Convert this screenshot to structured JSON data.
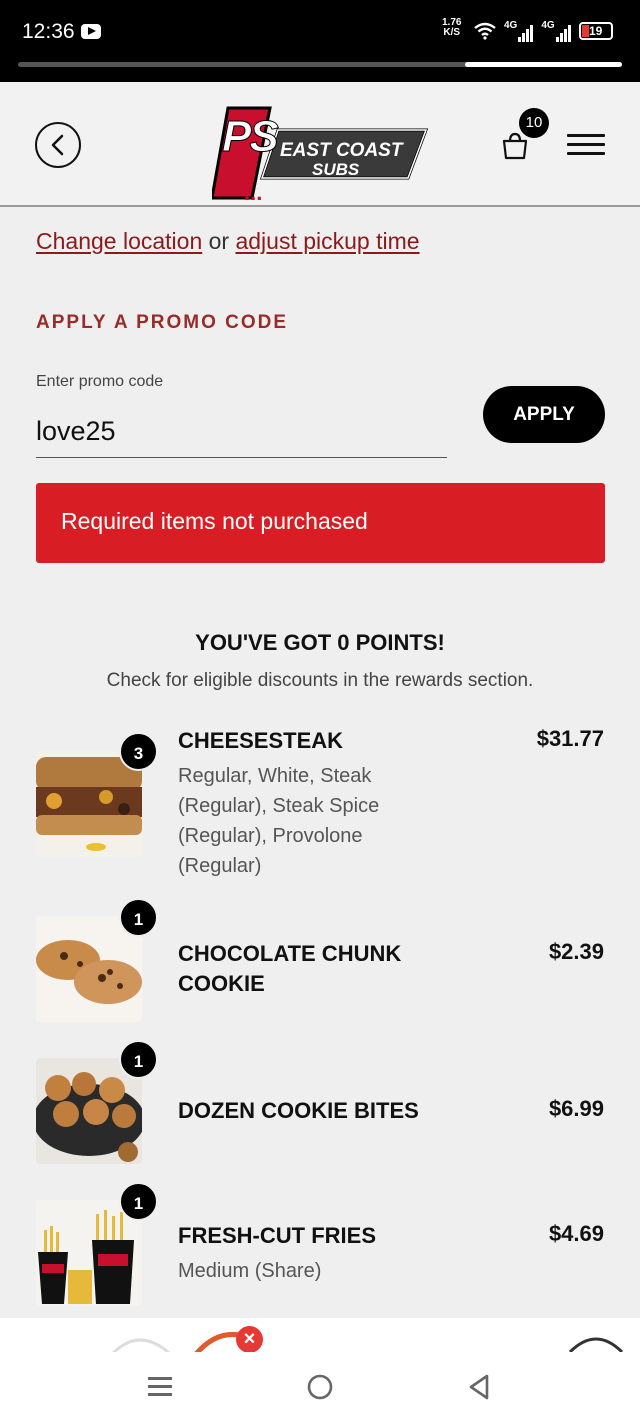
{
  "status_bar": {
    "time": "12:36",
    "net_speed_value": "1.76",
    "net_speed_unit": "K/S",
    "signal1": "4G",
    "signal2": "4G",
    "battery": "19"
  },
  "header": {
    "logo_text": "PS... EAST COAST SUBS",
    "logo_ps": "PS",
    "logo_line1": "EAST COAST",
    "logo_line2": "SUBS",
    "cart_count": "10"
  },
  "location": {
    "change_link": "Change location",
    "or_text": " or ",
    "pickup_link": "adjust pickup time"
  },
  "promo": {
    "heading": "APPLY A PROMO CODE",
    "label": "Enter promo code",
    "value": "love25",
    "apply_label": "APPLY",
    "error": "Required items not purchased"
  },
  "points": {
    "title": "YOU'VE GOT 0 POINTS!",
    "subtitle": "Check for eligible discounts in the rewards section."
  },
  "items": [
    {
      "qty": "3",
      "name": "CHEESESTEAK",
      "price": "$31.77",
      "desc": "Regular, White, Steak (Regular), Steak Spice (Regular), Provolone (Regular)"
    },
    {
      "qty": "1",
      "name": "CHOCOLATE CHUNK COOKIE",
      "price": "$2.39",
      "desc": ""
    },
    {
      "qty": "1",
      "name": "DOZEN COOKIE BITES",
      "price": "$6.99",
      "desc": ""
    },
    {
      "qty": "1",
      "name": "FRESH-CUT FRIES",
      "price": "$4.69",
      "desc": "Medium (Share)"
    }
  ],
  "colors": {
    "brand_red": "#d81e24",
    "promo_heading": "#9b2a2a",
    "link": "#8b1a1a"
  },
  "icons": [
    "back-chevron-icon",
    "cart-bag-icon",
    "hamburger-menu-icon",
    "nav-recents-icon",
    "nav-home-icon",
    "nav-back-icon"
  ]
}
